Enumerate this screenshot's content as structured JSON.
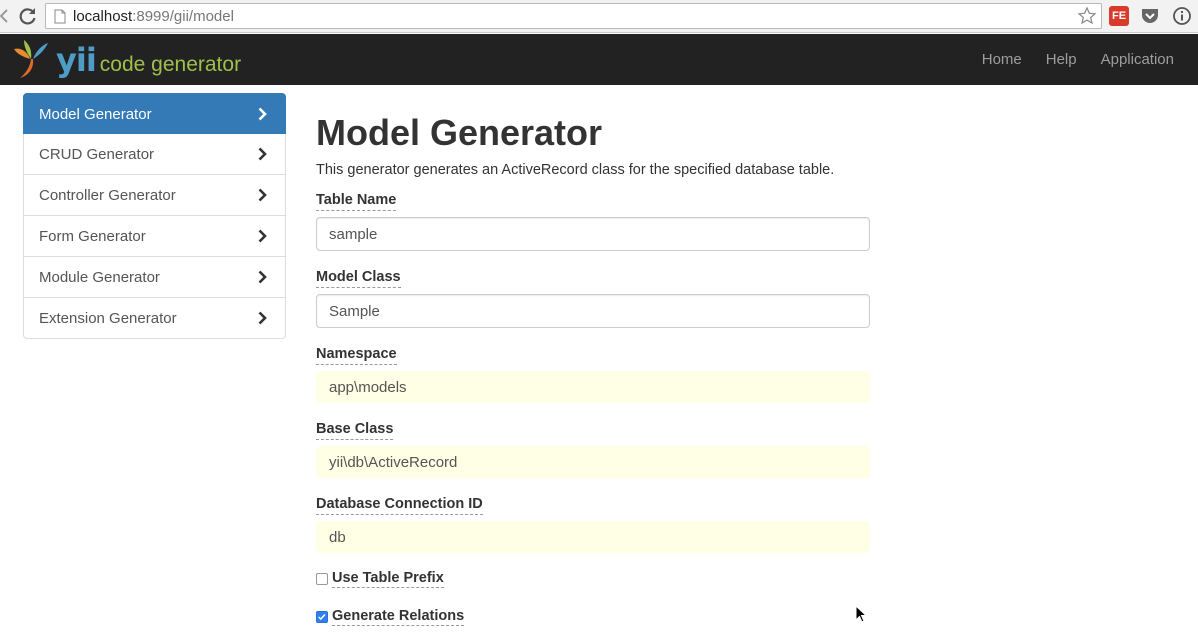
{
  "browser": {
    "url_host": "localhost",
    "url_path": ":8999/gii/model",
    "extensions": [
      "fe-extension-icon",
      "pocket-icon",
      "info-icon"
    ],
    "ext_fe_label": "FE"
  },
  "navbar": {
    "brand_yii": "yii",
    "brand_sub": "code generator",
    "links": [
      {
        "label": "Home"
      },
      {
        "label": "Help"
      },
      {
        "label": "Application"
      }
    ]
  },
  "sidebar": {
    "items": [
      {
        "label": "Model Generator",
        "active": true
      },
      {
        "label": "CRUD Generator",
        "active": false
      },
      {
        "label": "Controller Generator",
        "active": false
      },
      {
        "label": "Form Generator",
        "active": false
      },
      {
        "label": "Module Generator",
        "active": false
      },
      {
        "label": "Extension Generator",
        "active": false
      }
    ]
  },
  "main": {
    "title": "Model Generator",
    "description": "This generator generates an ActiveRecord class for the specified database table.",
    "fields": {
      "table_name": {
        "label": "Table Name",
        "value": "sample"
      },
      "model_class": {
        "label": "Model Class",
        "value": "Sample"
      },
      "namespace": {
        "label": "Namespace",
        "value": "app\\models"
      },
      "base_class": {
        "label": "Base Class",
        "value": "yii\\db\\ActiveRecord"
      },
      "db_connection": {
        "label": "Database Connection ID",
        "value": "db"
      }
    },
    "checkboxes": {
      "use_table_prefix": {
        "label": "Use Table Prefix",
        "checked": false
      },
      "generate_relations": {
        "label": "Generate Relations",
        "checked": true
      }
    }
  },
  "colors": {
    "navbar_bg": "#222222",
    "active_item": "#337ab7",
    "sticky_input": "#ffffe6",
    "brand_blue": "#4e9cc8",
    "brand_green": "#9ec04a"
  }
}
